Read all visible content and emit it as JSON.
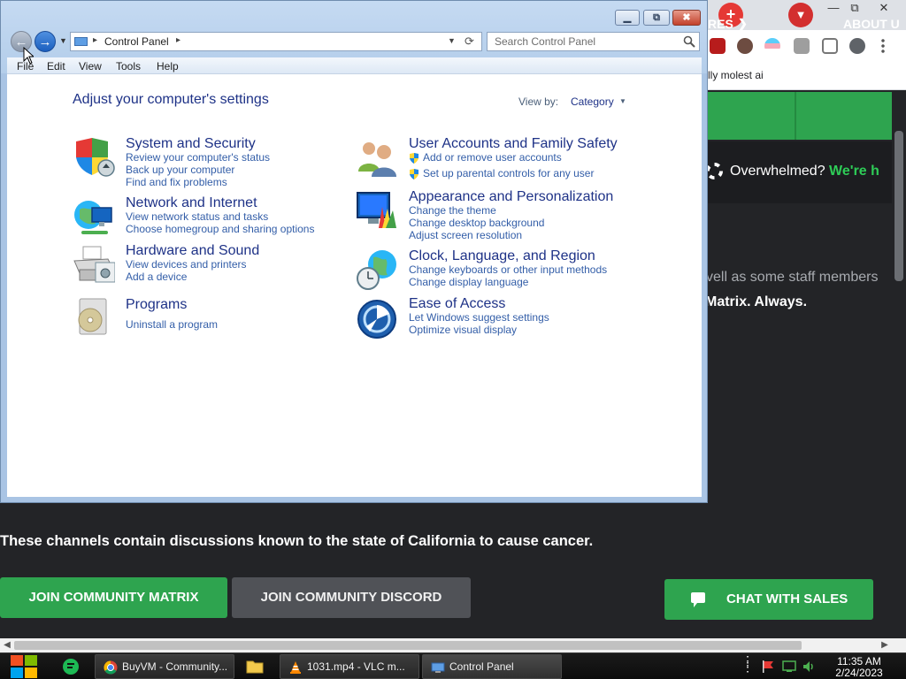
{
  "browser": {
    "bookmark_text": "lly molest ai",
    "nav_items": [
      "RES",
      "ABOUT U"
    ],
    "banner_text_white": "Overwhelmed? ",
    "banner_text_green": "We're h",
    "body_text_1": "vell as some staff members",
    "body_text_2": "Matrix. Always.",
    "cancer_text": "These channels contain discussions known to the state of California to cause cancer.",
    "btn_matrix": "JOIN COMMUNITY MATRIX",
    "btn_discord": "JOIN COMMUNITY DISCORD",
    "btn_sales": "CHAT WITH SALES",
    "colors": {
      "accent_green": "#2ea44f",
      "page_bg": "#232427",
      "discord_btn": "#505257"
    }
  },
  "control_panel": {
    "window_title": "Control Panel",
    "address": {
      "crumb": "Control Panel"
    },
    "search": {
      "placeholder": "Search Control Panel"
    },
    "menu": [
      "File",
      "Edit",
      "View",
      "Tools",
      "Help"
    ],
    "heading": "Adjust your computer's settings",
    "view_by_label": "View by:",
    "view_by_value": "Category",
    "categories": [
      {
        "title": "System and Security",
        "links": [
          "Review your computer's status",
          "Back up your computer",
          "Find and fix problems"
        ],
        "icon": "shield-flag-icon"
      },
      {
        "title": "Network and Internet",
        "links": [
          "View network status and tasks",
          "Choose homegroup and sharing options"
        ],
        "icon": "globe-network-icon"
      },
      {
        "title": "Hardware and Sound",
        "links": [
          "View devices and printers",
          "Add a device"
        ],
        "icon": "printer-icon"
      },
      {
        "title": "Programs",
        "links": [
          "Uninstall a program"
        ],
        "icon": "programs-disc-icon"
      },
      {
        "title": "User Accounts and Family Safety",
        "links": [
          "Add or remove user accounts",
          "Set up parental controls for any user"
        ],
        "icon": "users-icon"
      },
      {
        "title": "Appearance and Personalization",
        "links": [
          "Change the theme",
          "Change desktop background",
          "Adjust screen resolution"
        ],
        "icon": "monitor-palette-icon"
      },
      {
        "title": "Clock, Language, and Region",
        "links": [
          "Change keyboards or other input methods",
          "Change display language"
        ],
        "icon": "clock-globe-icon"
      },
      {
        "title": "Ease of Access",
        "links": [
          "Let Windows suggest settings",
          "Optimize visual display"
        ],
        "icon": "ease-of-access-icon"
      }
    ]
  },
  "taskbar": {
    "tasks": [
      {
        "label": "BuyVM - Community...",
        "icon": "chrome-icon"
      },
      {
        "label": "1031.mp4 - VLC m...",
        "icon": "vlc-icon"
      },
      {
        "label": "Control Panel",
        "icon": "control-panel-icon"
      }
    ],
    "clock_time": "11:35 AM",
    "clock_date": "2/24/2023"
  }
}
